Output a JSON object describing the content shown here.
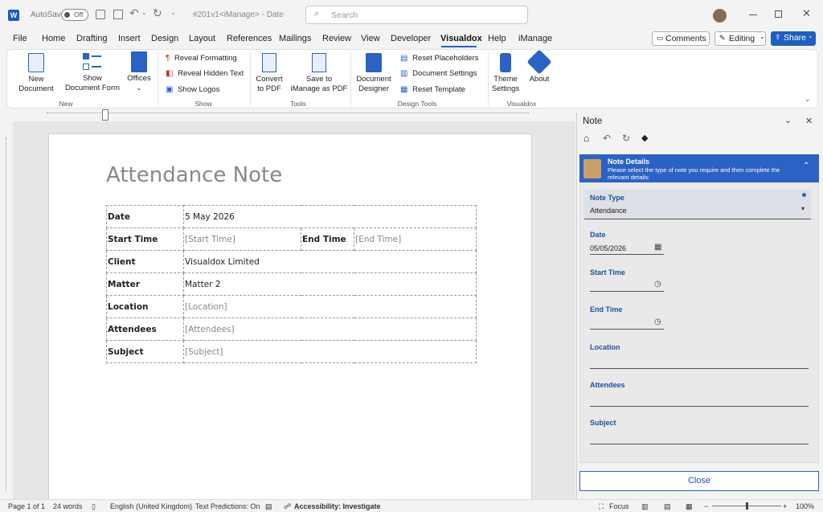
{
  "titlebar": {
    "autosave_label": "AutoSave",
    "autosave_state": "Off",
    "doc_title": "#201v1<iManage> - Date",
    "search_placeholder": "Search"
  },
  "menu": {
    "items": [
      "File",
      "Home",
      "Drafting",
      "Insert",
      "Design",
      "Layout",
      "References",
      "Mailings",
      "Review",
      "View",
      "Developer",
      "Visualdox",
      "Help",
      "iManage"
    ],
    "active": "Visualdox"
  },
  "actions": {
    "comments": "Comments",
    "editing": "Editing",
    "share": "Share"
  },
  "ribbon": {
    "new_document": "New\nDocument",
    "show_document_form": "Show\nDocument Form",
    "offices": "Offices",
    "reveal_formatting": "Reveal Formatting",
    "reveal_hidden_text": "Reveal Hidden Text",
    "show_logos": "Show Logos",
    "convert_to_pdf": "Convert\nto PDF",
    "save_to_imanage": "Save to\niManage as PDF",
    "document_designer": "Document\nDesigner",
    "reset_placeholders": "Reset Placeholders",
    "document_settings": "Document Settings",
    "reset_template": "Reset Template",
    "theme_settings": "Theme\nSettings",
    "about": "About",
    "groups": {
      "new": "New",
      "show": "Show",
      "tools": "Tools",
      "design_tools": "Design Tools",
      "visualdox": "Visualdox"
    }
  },
  "document": {
    "heading": "Attendance Note",
    "rows": [
      {
        "label": "Date",
        "value": "5 May 2026",
        "placeholder": false
      },
      {
        "label": "Start Time",
        "value": "[Start Time]",
        "placeholder": true,
        "label2": "End Time",
        "value2": "[End Time]"
      },
      {
        "label": "Client",
        "value": "Visualdox Limited",
        "placeholder": false
      },
      {
        "label": "Matter",
        "value": "Matter 2",
        "placeholder": false
      },
      {
        "label": "Location",
        "value": "[Location]",
        "placeholder": true
      },
      {
        "label": "Attendees",
        "value": "[Attendees]",
        "placeholder": true
      },
      {
        "label": "Subject",
        "value": "[Subject]",
        "placeholder": true
      }
    ]
  },
  "pane": {
    "title": "Note",
    "section_title": "Note Details",
    "section_desc": "Please select the type of note you require and then complete the relevant details:",
    "note_type_label": "Note Type",
    "note_type_value": "Attendance",
    "date_label": "Date",
    "date_value": "05/05/2026",
    "start_time_label": "Start Time",
    "end_time_label": "End Time",
    "location_label": "Location",
    "attendees_label": "Attendees",
    "subject_label": "Subject",
    "close_button": "Close",
    "colors": {
      "accent": "#2b62c4",
      "header_bg": "#2b62c4"
    }
  },
  "status": {
    "page": "Page 1 of 1",
    "words": "24 words",
    "language": "English (United Kingdom)",
    "predictions": "Text Predictions: On",
    "accessibility": "Accessibility: Investigate",
    "focus": "Focus",
    "zoom": "100%"
  }
}
